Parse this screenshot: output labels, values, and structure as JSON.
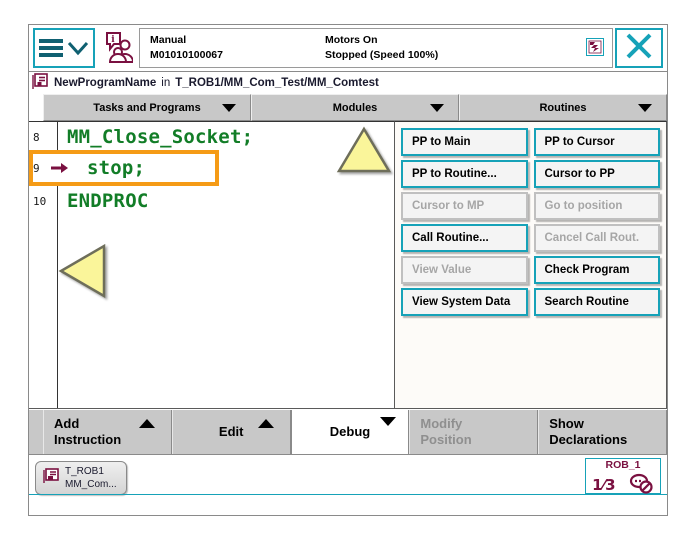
{
  "statusbar": {
    "menu_icon": "hamburger-menu-icon",
    "operator_icon": "operator-info-icon",
    "mode": "Manual",
    "controller_id": "M01010100067",
    "motors_state": "Motors On",
    "exec_state": "Stopped (Speed 100%)",
    "indicator_icon": "program-status-icon",
    "close_icon": "close-icon",
    "accent_color": "#16a2b8",
    "purple_color": "#7a1040"
  },
  "breadcrumb": {
    "icon": "program-file-icon",
    "program_name": "NewProgramName",
    "connector": "in",
    "path": "T_ROB1/MM_Com_Test/MM_Comtest"
  },
  "tabs": [
    {
      "label": "Tasks and Programs",
      "caret": "chevron-down-icon"
    },
    {
      "label": "Modules",
      "caret": "chevron-down-icon"
    },
    {
      "label": "Routines",
      "caret": "chevron-down-icon"
    }
  ],
  "editor": {
    "lines": [
      {
        "number": "8",
        "text": "MM_Close_Socket;",
        "selected": false,
        "pp": false
      },
      {
        "number": "9",
        "text": "stop;",
        "selected": true,
        "pp": true
      },
      {
        "number": "10",
        "text": "ENDPROC",
        "selected": false,
        "pp": false
      }
    ],
    "code_color": "#127d27",
    "selection_color": "#f59b16",
    "scroll_up_marker": "scroll-up-triangle-icon",
    "scroll_left_marker": "scroll-left-triangle-icon",
    "marker_color": "#faf59a"
  },
  "debug_panel": {
    "rows": [
      [
        {
          "label": "PP to Main",
          "enabled": true
        },
        {
          "label": "PP to Cursor",
          "enabled": true
        }
      ],
      [
        {
          "label": "PP to Routine...",
          "enabled": true
        },
        {
          "label": "Cursor to PP",
          "enabled": true
        }
      ],
      [
        {
          "label": "Cursor to MP",
          "enabled": false
        },
        {
          "label": "Go to position",
          "enabled": false
        }
      ],
      [
        {
          "label": "Call Routine...",
          "enabled": true
        },
        {
          "label": "Cancel Call Rout.",
          "enabled": false
        }
      ],
      [
        {
          "label": "View Value",
          "enabled": false
        },
        {
          "label": "Check Program",
          "enabled": true
        }
      ],
      [
        {
          "label": "View System Data",
          "enabled": true
        },
        {
          "label": "Search Routine",
          "enabled": true
        }
      ]
    ]
  },
  "toolbar": [
    {
      "line1": "Add",
      "line2": "Instruction",
      "caret": "up",
      "enabled": true,
      "active": false
    },
    {
      "line1": "Edit",
      "line2": "",
      "caret": "up",
      "enabled": true,
      "active": false
    },
    {
      "line1": "Debug",
      "line2": "",
      "caret": "down",
      "enabled": true,
      "active": true
    },
    {
      "line1": "Modify",
      "line2": "Position",
      "caret": "none",
      "enabled": false,
      "active": false
    },
    {
      "line1": "Show",
      "line2": "Declarations",
      "caret": "none",
      "enabled": true,
      "active": false
    }
  ],
  "taskbar": {
    "task_icon": "program-editor-icon",
    "task_line1": "T_ROB1",
    "task_line2": "MM_Com...",
    "robot_name": "ROB_1",
    "fraction_numerator": "1",
    "fraction_denominator": "3",
    "robot_icon": "robot-axis-disabled-icon"
  }
}
